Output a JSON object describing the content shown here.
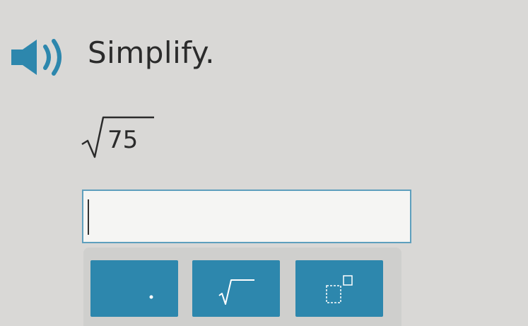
{
  "question": {
    "prompt": "Simplify.",
    "radicand": "75",
    "audio_icon": "speaker-icon"
  },
  "answer": {
    "value": ""
  },
  "keypad": {
    "keys": [
      {
        "name": "decimal-point",
        "icon": "dot-icon"
      },
      {
        "name": "square-root",
        "icon": "sqrt-icon"
      },
      {
        "name": "exponent",
        "icon": "superscript-icon"
      }
    ]
  },
  "colors": {
    "accent": "#2d87ad",
    "background": "#d9d8d6",
    "input_border": "#5e9fbd",
    "text": "#2b2b2b"
  }
}
